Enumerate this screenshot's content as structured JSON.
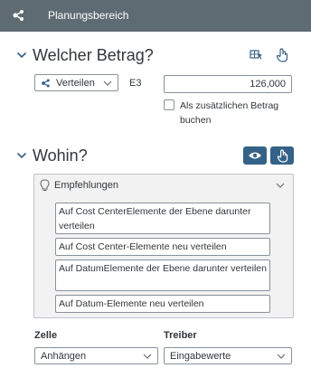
{
  "titlebar": {
    "title": "Planungsbereich",
    "icon": "distribute-icon"
  },
  "section_amount": {
    "title": "Welcher Betrag?",
    "distribute_dropdown": {
      "label": "Verteilen",
      "icon": "distribute-icon"
    },
    "cell_ref": "E3",
    "amount_value": "126,000",
    "checkbox_label": "Als zusätzlichen Betrag buchen",
    "checkbox_checked": false
  },
  "section_target": {
    "title": "Wohin?",
    "recommendations": {
      "header": "Empfehlungen",
      "items": [
        "Auf Cost CenterElemente der Ebene darunter verteilen",
        "Auf Cost Center-Elemente neu verteilen",
        "Auf DatumElemente der Ebene darunter verteilen",
        "Auf Datum-Elemente neu verteilen"
      ]
    },
    "cell_label": "Zelle",
    "cell_value": "Anhängen",
    "driver_label": "Treiber",
    "driver_value": "Eingabewerte"
  },
  "colors": {
    "titlebar": "#5f6b73",
    "accent": "#346187",
    "panel_bg": "#f2f2f2"
  }
}
